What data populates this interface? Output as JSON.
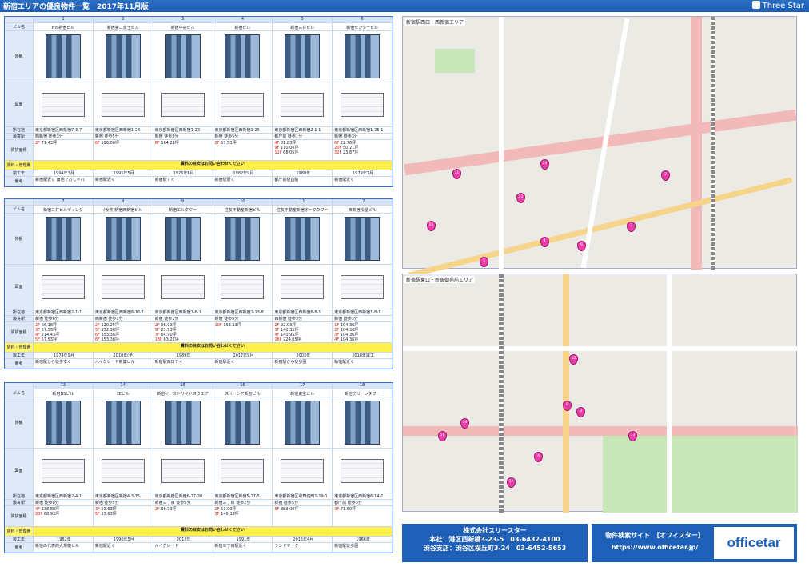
{
  "header": {
    "title": "新宿エリアの優良物件一覧　2017年11月版",
    "brand": "Three Star"
  },
  "rows": {
    "name": "ビル名",
    "exterior": "外観",
    "plan": "図面",
    "address": "所在地",
    "nearest": "最寄駅",
    "area": "賃貸面積",
    "notice_label": "賃料・管理費",
    "built": "竣工年",
    "note": "備考"
  },
  "blocks": [
    {
      "buildings": [
        {
          "no": "1",
          "name": "NIS新宿ビル",
          "addr": "東京都新宿区西新宿7-3-7",
          "station": "西新宿 徒歩3分",
          "spaces": [
            [
              "2F",
              "71.43坪"
            ]
          ],
          "built": "1994年3月",
          "note": "新宿駅近く 角地でおしゃれ"
        },
        {
          "no": "2",
          "name": "新宿第二京王ビル",
          "addr": "東京都新宿区西新宿1-24",
          "station": "新宿 徒歩5分",
          "spaces": [
            [
              "6F",
              "196.00坪"
            ]
          ],
          "built": "1995年5月",
          "note": "新宿駅近く"
        },
        {
          "no": "3",
          "name": "新宿中央ビル",
          "addr": "東京都新宿区西新宿1-23",
          "station": "新宿 徒歩3分",
          "spaces": [
            [
              "6F",
              "164.21坪"
            ]
          ],
          "built": "1976年6月",
          "note": "新宿駅すぐ"
        },
        {
          "no": "4",
          "name": "新宿ビル",
          "addr": "東京都新宿区西新宿1-25",
          "station": "新宿 徒歩5分",
          "spaces": [
            [
              "2F",
              "57.53坪"
            ]
          ],
          "built": "1982年9月",
          "note": "新宿駅近く"
        },
        {
          "no": "5",
          "name": "新宿三井ビル",
          "addr": "東京都新宿区西新宿2-1-1",
          "station": "都庁前 徒歩1分",
          "spaces": [
            [
              "4F",
              "81.83坪"
            ],
            [
              "9F",
              "110.00坪"
            ],
            [
              "11F",
              "68.05坪"
            ]
          ],
          "built": "1980年",
          "note": "都庁前駅直結"
        },
        {
          "no": "6",
          "name": "新宿センタービル",
          "addr": "東京都新宿区西新宿1-25-1",
          "station": "新宿 徒歩3分",
          "spaces": [
            [
              "6F",
              "22.78坪"
            ],
            [
              "20F",
              "50.21坪"
            ],
            [
              "32F",
              "23.87坪"
            ]
          ],
          "built": "1979年7月",
          "note": "新宿駅近く"
        }
      ],
      "notice": "賃料の目安はお問い合わせください"
    },
    {
      "buildings": [
        {
          "no": "7",
          "name": "新宿三井ビルディング",
          "addr": "東京都新宿区西新宿2-1-1",
          "station": "新宿 徒歩6分",
          "spaces": [
            [
              "2F",
              "66.18坪"
            ],
            [
              "3F",
              "57.53坪"
            ],
            [
              "4F",
              "214.43坪"
            ],
            [
              "5F",
              "57.53坪"
            ]
          ],
          "built": "1974年9月",
          "note": "新宿駅から徒歩すぐ"
        },
        {
          "no": "8",
          "name": "(仮称)新宿西新宿ビル",
          "addr": "東京都新宿区西新宿6-16-1",
          "station": "西新宿 徒歩1分",
          "spaces": [
            [
              "2F",
              "120.25坪"
            ],
            [
              "5F",
              "152.36坪"
            ],
            [
              "6F",
              "153.38坪"
            ],
            [
              "8F",
              "153.38坪"
            ]
          ],
          "built": "2018年(予)",
          "note": "ハイグレード新築ビル"
        },
        {
          "no": "9",
          "name": "新宿エルタワー",
          "addr": "東京都新宿区西新宿1-6-1",
          "station": "新宿 徒歩1分",
          "spaces": [
            [
              "2F",
              "96.03坪"
            ],
            [
              "5F",
              "21.73坪"
            ],
            [
              "7F",
              "64.90坪"
            ],
            [
              "13F",
              "63.22坪"
            ]
          ],
          "built": "1989年",
          "note": "新宿駅西口すぐ"
        },
        {
          "no": "10",
          "name": "住友不動産新宿ビル",
          "addr": "東京都新宿区西新宿1-13-8",
          "station": "新宿 徒歩5分",
          "spaces": [
            [
              "10F",
              "153.13坪"
            ]
          ],
          "built": "2017年9月",
          "note": "新宿駅近く"
        },
        {
          "no": "11",
          "name": "住友不動産新宿オークタワー",
          "addr": "東京都新宿区西新宿6-8-1",
          "station": "西新宿 徒歩3分",
          "spaces": [
            [
              "2F",
              "92.03坪"
            ],
            [
              "3F",
              "140.35坪"
            ],
            [
              "4F",
              "140.95坪"
            ],
            [
              "16F",
              "224.05坪"
            ]
          ],
          "built": "2003年",
          "note": "新宿駅から徒歩圏"
        },
        {
          "no": "12",
          "name": "西新宿松屋ビル",
          "addr": "東京都新宿区西新宿1-8-1",
          "station": "新宿 徒歩3分",
          "spaces": [
            [
              "1F",
              "104.36坪"
            ],
            [
              "2F",
              "104.36坪"
            ],
            [
              "3F",
              "104.36坪"
            ],
            [
              "4F",
              "104.36坪"
            ]
          ],
          "built": "2018年竣工",
          "note": "新宿駅近く"
        }
      ],
      "notice": "賃料の目安はお問い合わせください"
    },
    {
      "buildings": [
        {
          "no": "13",
          "name": "新宿NSビル",
          "addr": "東京都新宿区西新宿2-4-1",
          "station": "新宿 徒歩8分",
          "spaces": [
            [
              "4F",
              "138.80坪"
            ],
            [
              "20F",
              "68.93坪"
            ]
          ],
          "built": "1982年",
          "note": "新宿の代表的大規模ビル"
        },
        {
          "no": "14",
          "name": "3Eビル",
          "addr": "東京都新宿区新宿4-3-15",
          "station": "新宿 徒歩5分",
          "spaces": [
            [
              "3F",
              "53.63坪"
            ],
            [
              "5F",
              "53.63坪"
            ]
          ],
          "built": "1990年5月",
          "note": "新宿駅近く"
        },
        {
          "no": "15",
          "name": "新宿イーストサイドスクエア",
          "addr": "東京都新宿区新宿6-27-30",
          "station": "新宿三丁目 徒歩5分",
          "spaces": [
            [
              "2F",
              "66.73坪"
            ]
          ],
          "built": "2012年",
          "note": "ハイグレード"
        },
        {
          "no": "16",
          "name": "スペーシア新宿ビル",
          "addr": "東京都新宿区新宿5-17-5",
          "station": "新宿三丁目 徒歩2分",
          "spaces": [
            [
              "2F",
              "51.00坪"
            ],
            [
              "3F",
              "140.33坪"
            ]
          ],
          "built": "1991年",
          "note": "新宿三丁目駅近く"
        },
        {
          "no": "17",
          "name": "新宿東宝ビル",
          "addr": "東京都新宿区歌舞伎町1-19-1",
          "station": "新宿 徒歩5分",
          "spaces": [
            [
              "8F",
              "883.00坪"
            ]
          ],
          "built": "2015年4月",
          "note": "ランドマーク"
        },
        {
          "no": "18",
          "name": "新宿グリーンタワー",
          "addr": "東京都新宿区西新宿6-14-1",
          "station": "都庁前 徒歩3分",
          "spaces": [
            [
              "3F",
              "71.80坪"
            ]
          ],
          "built": "1986年",
          "note": "新宿駅徒歩圏"
        }
      ],
      "notice": "賃料の目安はお問い合わせください"
    }
  ],
  "maps": [
    {
      "title": "新宿駅西口・西新宿エリア",
      "pins": [
        "31",
        "24",
        "2",
        "25",
        "3",
        "1",
        "6",
        "26",
        "5"
      ]
    },
    {
      "title": "新宿駅東口・新宿御苑前エリア",
      "pins": [
        "12",
        "8",
        "9",
        "14",
        "16",
        "13",
        "4",
        "17"
      ]
    }
  ],
  "footer": {
    "company": "株式会社スリースター",
    "hq": "本社：港区西新橋3-23-5　03-6432-4100",
    "branch": "渋谷支店：渋谷区桜丘町3-24　03-6452-5653",
    "site_label": "物件検索サイト　【オフィスター】",
    "site_url": "https://www.officetar.jp/",
    "logo": "officetar"
  }
}
